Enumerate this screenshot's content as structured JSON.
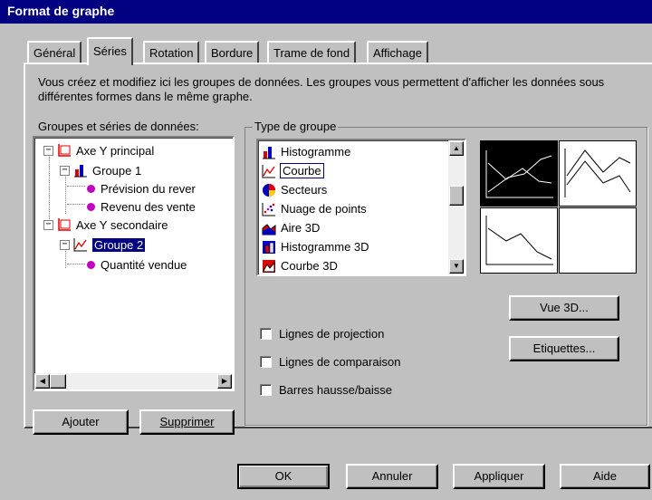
{
  "window": {
    "title": "Format de graphe"
  },
  "tabs": [
    {
      "label": "Général"
    },
    {
      "label": "Séries"
    },
    {
      "label": "Rotation"
    },
    {
      "label": "Bordure"
    },
    {
      "label": "Trame de fond"
    },
    {
      "label": "Affichage"
    }
  ],
  "description": "Vous créez et modifiez ici les groupes de données. Les groupes vous permettent d'afficher les données sous différentes formes dans le même graphe.",
  "tree": {
    "label": "Groupes et séries de données:",
    "nodes": [
      {
        "label": "Axe Y principal",
        "expander": "−"
      },
      {
        "label": "Groupe 1",
        "expander": "−"
      },
      {
        "label": "Prévision du rever"
      },
      {
        "label": "Revenu des vente"
      },
      {
        "label": "Axe Y secondaire",
        "expander": "−"
      },
      {
        "label": "Groupe 2",
        "expander": "−"
      },
      {
        "label": "Quantité vendue"
      }
    ],
    "selected": "Groupe 2"
  },
  "buttons": {
    "add": "Ajouter",
    "delete": "Supprimer",
    "view3d": "Vue 3D...",
    "labels": "Etiquettes...",
    "ok": "OK",
    "cancel": "Annuler",
    "apply": "Appliquer",
    "help": "Aide"
  },
  "group_type": {
    "title": "Type de groupe",
    "items": [
      {
        "label": "Histogramme",
        "icon": "bar-chart-icon"
      },
      {
        "label": "Courbe",
        "icon": "line-chart-icon"
      },
      {
        "label": "Secteurs",
        "icon": "pie-chart-icon"
      },
      {
        "label": "Nuage de points",
        "icon": "scatter-chart-icon"
      },
      {
        "label": "Aire 3D",
        "icon": "area-3d-icon"
      },
      {
        "label": "Histogramme 3D",
        "icon": "bar-3d-icon"
      },
      {
        "label": "Courbe 3D",
        "icon": "line-3d-icon"
      }
    ],
    "selected": "Courbe"
  },
  "checkboxes": [
    {
      "label": "Lignes de projection",
      "checked": false
    },
    {
      "label": "Lignes de comparaison",
      "checked": false
    },
    {
      "label": "Barres hausse/baisse",
      "checked": false
    }
  ],
  "colors": {
    "title_bar": "#000080",
    "face": "#c0c0c0",
    "series_marker": "#c000c0",
    "selection": "#000080"
  }
}
